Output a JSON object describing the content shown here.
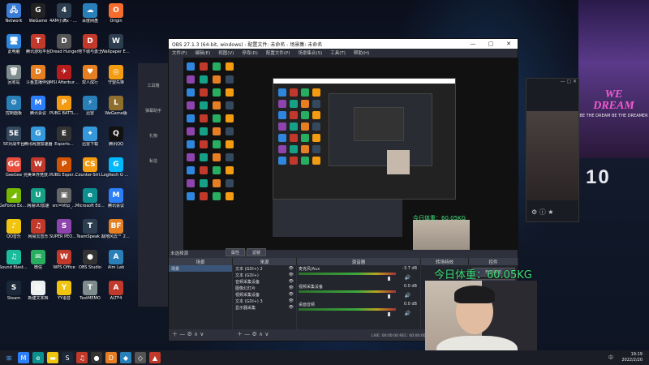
{
  "desktop": {
    "col1": [
      {
        "label": "Network",
        "color": "#3a7bd5",
        "glyph": "🖧",
        "icon": "network-icon"
      },
      {
        "label": "此电脑",
        "color": "#2e86de",
        "glyph": "🖥",
        "icon": "computer-icon"
      },
      {
        "label": "回收站",
        "color": "#7f8c8d",
        "glyph": "🗑",
        "icon": "recycle-bin-icon"
      },
      {
        "label": "控制面板",
        "color": "#2980b9",
        "glyph": "⚙",
        "icon": "control-panel-icon"
      },
      {
        "label": "5E对战平台",
        "color": "#34495e",
        "glyph": "5E",
        "icon": "5e-icon"
      },
      {
        "label": "GeeGee",
        "color": "#e74c3c",
        "glyph": "GG",
        "icon": "geegee-icon"
      },
      {
        "label": "GeForce Experience",
        "color": "#76b900",
        "glyph": "◢",
        "icon": "geforce-icon"
      },
      {
        "label": "QQ音乐",
        "color": "#f1c40f",
        "glyph": "♪",
        "icon": "qqmusic-icon"
      },
      {
        "label": "Sound Blaster...",
        "color": "#1abc9c",
        "glyph": "♫",
        "icon": "soundblaster-icon"
      },
      {
        "label": "Steam",
        "color": "#1b2838",
        "glyph": "S",
        "icon": "steam-icon"
      }
    ],
    "col2": [
      {
        "label": "WeGame",
        "color": "#222",
        "glyph": "G",
        "icon": "wegame-icon"
      },
      {
        "label": "腾讯游戏平台",
        "color": "#c0392b",
        "glyph": "T",
        "icon": "tencent-game-icon"
      },
      {
        "label": "斗鱼直播伴侣",
        "color": "#e67e22",
        "glyph": "D",
        "icon": "douyu-icon"
      },
      {
        "label": "腾讯会议",
        "color": "#2d7ff9",
        "glyph": "M",
        "icon": "tencent-meeting-icon"
      },
      {
        "label": "腾讯网游加速器",
        "color": "#3498db",
        "glyph": "G",
        "icon": "accelerator-icon"
      },
      {
        "label": "完美世界竞技平台",
        "color": "#c0392b",
        "glyph": "W",
        "icon": "perfect-world-icon"
      },
      {
        "label": "网易UU加速",
        "color": "#16a085",
        "glyph": "U",
        "icon": "uu-icon"
      },
      {
        "label": "网易云音乐",
        "color": "#c0392b",
        "glyph": "♫",
        "icon": "netease-music-icon"
      },
      {
        "label": "微信",
        "color": "#27ae60",
        "glyph": "✉",
        "icon": "wechat-icon"
      },
      {
        "label": "新建文本档",
        "color": "#ecf0f1",
        "glyph": "▤",
        "icon": "text-file-icon"
      }
    ],
    "col3": [
      {
        "label": "4AM小满x - 直播_热...",
        "color": "#2c3e50",
        "glyph": "4",
        "icon": "shortcut-icon"
      },
      {
        "label": "Dread Hunger",
        "color": "#555",
        "glyph": "D",
        "icon": "dreadhunger-icon"
      },
      {
        "label": "MSI Afterburner",
        "color": "#b71c1c",
        "glyph": "✈",
        "icon": "afterburner-icon"
      },
      {
        "label": "PUBG BATTLEGR...",
        "color": "#f39c12",
        "glyph": "P",
        "icon": "pubg-icon"
      },
      {
        "label": "Esports...",
        "color": "#333",
        "glyph": "E",
        "icon": "esports-icon"
      },
      {
        "label": "PUBG Esports...",
        "color": "#d35400",
        "glyph": "P",
        "icon": "pubg-esports-icon"
      },
      {
        "label": "src=http_...",
        "color": "#666",
        "glyph": "▣",
        "icon": "image-file-icon"
      },
      {
        "label": "SUPER PEOPLE...",
        "color": "#8e44ad",
        "glyph": "S",
        "icon": "superpeople-icon"
      },
      {
        "label": "WPS Office",
        "color": "#c0392b",
        "glyph": "W",
        "icon": "wps-icon"
      },
      {
        "label": "YY语音",
        "color": "#f1c40f",
        "glyph": "Y",
        "icon": "yy-icon"
      }
    ],
    "col4": [
      {
        "label": "百度网盘",
        "color": "#2980b9",
        "glyph": "☁",
        "icon": "baidu-pan-icon"
      },
      {
        "label": "地下城与勇士",
        "color": "#c0392b",
        "glyph": "D",
        "icon": "dnf-icon"
      },
      {
        "label": "双人成行",
        "color": "#e67e22",
        "glyph": "♥",
        "icon": "it-takes-two-icon"
      },
      {
        "label": "迅雷",
        "color": "#2980b9",
        "glyph": "⚡",
        "icon": "xunlei-icon"
      },
      {
        "label": "迅雷下载",
        "color": "#3498db",
        "glyph": "✦",
        "icon": "xunlei-download-icon"
      },
      {
        "label": "Counter-Strike Global Off...",
        "color": "#f39c12",
        "glyph": "CS",
        "icon": "csgo-icon"
      },
      {
        "label": "Microsoft Edge",
        "color": "#0b8f8f",
        "glyph": "e",
        "icon": "edge-icon"
      },
      {
        "label": "TeamSpeak 3",
        "color": "#2c3e50",
        "glyph": "T",
        "icon": "teamspeak-icon"
      },
      {
        "label": "OBS Studio",
        "color": "#333",
        "glyph": "●",
        "icon": "obs-icon"
      },
      {
        "label": "TestMEMO",
        "color": "#7f8c8d",
        "glyph": "T",
        "icon": "testmemo-icon"
      }
    ],
    "col5": [
      {
        "label": "Origin",
        "color": "#f56c2d",
        "glyph": "O",
        "icon": "origin-icon"
      },
      {
        "label": "Wallpaper Engine:...",
        "color": "#2c3e50",
        "glyph": "W",
        "icon": "wallpaper-engine-icon"
      },
      {
        "label": "守望先锋",
        "color": "#f39c12",
        "glyph": "◎",
        "icon": "overwatch-icon"
      },
      {
        "label": "WeGame版",
        "color": "#8e6f2e",
        "glyph": "L",
        "icon": "lol-icon"
      },
      {
        "label": "腾讯QQ",
        "color": "#111",
        "glyph": "Q",
        "icon": "qq-icon"
      },
      {
        "label": "Logitech G HUB",
        "color": "#00b8fc",
        "glyph": "G",
        "icon": "ghub-icon"
      },
      {
        "label": "腾讯会议",
        "color": "#2d7ff9",
        "glyph": "M",
        "icon": "meeting-icon"
      },
      {
        "label": "战地风云™ 2042",
        "color": "#e67e22",
        "glyph": "BF",
        "icon": "bf2042-icon"
      },
      {
        "label": "Aim Lab",
        "color": "#2980b9",
        "glyph": "A",
        "icon": "aimlab-icon"
      },
      {
        "label": "ALTF4",
        "color": "#c0392b",
        "glyph": "A",
        "icon": "altf4-icon"
      }
    ]
  },
  "obs": {
    "title": "OBS 27.1.3 (64-bit, windows) - 配置文件: 未命名 - 场景集: 未命名",
    "menu": [
      "文件(F)",
      "编辑(E)",
      "视图(V)",
      "停靠(D)",
      "配置文件(P)",
      "场景集合(S)",
      "工具(T)",
      "帮助(H)"
    ],
    "no_source": "未选择源",
    "props": "属性",
    "filters": "滤镜",
    "docks": {
      "scenes": "场景",
      "sources": "来源",
      "mixer": "混音器",
      "transitions": "转场特效",
      "controls": "控件"
    },
    "scene_item": "场景",
    "sources": [
      "文本 (GDI+) 2",
      "文本 (GDI+)",
      "音频采集设备",
      "图像幻灯片",
      "视频采集设备",
      "文本 (GDI+) 3",
      "显示器采集"
    ],
    "mixer": [
      {
        "name": "麦克风/Aux",
        "db": "-3.7 dB"
      },
      {
        "name": "视频采集设备",
        "db": "0.0 dB"
      },
      {
        "name": "桌面音频",
        "db": "0.0 dB"
      }
    ],
    "status": "LIVE: 00:00:00  REC: 00:00:00  CPU: 2.3%, 60.00 fps",
    "right_buttons": [
      "开始推流",
      "开始录制",
      "工作室模式",
      "设置",
      "退出"
    ]
  },
  "overlay": {
    "weight": "今日体重：60.05KG"
  },
  "poster": {
    "title_line1": "WE",
    "title_line2": "DREAM",
    "sub": "BE THE DREAM BE THE DREAMER"
  },
  "big_numbers": [
    "10",
    "10"
  ],
  "sidepanel": {
    "item1": "工具箱",
    "item2": "弹幕助手",
    "item3": "礼物",
    "item4": "私信"
  },
  "taskbar": {
    "time": "19:19",
    "date": "2022/2/20",
    "lang": "中"
  }
}
